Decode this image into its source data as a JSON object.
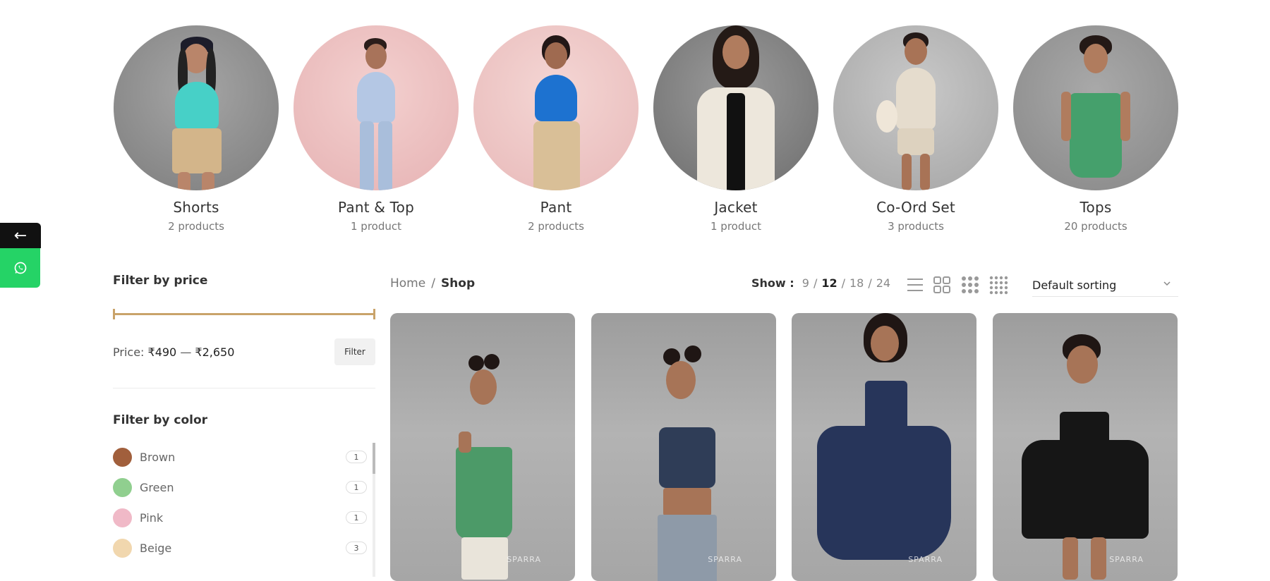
{
  "categories": [
    {
      "name": "Shorts",
      "count": "2 products"
    },
    {
      "name": "Pant & Top",
      "count": "1 product"
    },
    {
      "name": "Pant",
      "count": "2 products"
    },
    {
      "name": "Jacket",
      "count": "1 product"
    },
    {
      "name": "Co-Ord Set",
      "count": "3 products"
    },
    {
      "name": "Tops",
      "count": "20 products"
    }
  ],
  "side_tabs": {
    "back_icon": "←",
    "whatsapp_icon": "whatsapp-icon"
  },
  "price_filter": {
    "title": "Filter by price",
    "price_label": "Price:",
    "min": "₹490",
    "dash": "—",
    "max": "₹2,650",
    "button": "Filter"
  },
  "color_filter": {
    "title": "Filter by color",
    "items": [
      {
        "label": "Brown",
        "count": "1",
        "color": "#a15f3c"
      },
      {
        "label": "Green",
        "count": "1",
        "color": "#90cf8f"
      },
      {
        "label": "Pink",
        "count": "1",
        "color": "#f0b9c7"
      },
      {
        "label": "Beige",
        "count": "3",
        "color": "#f1d7ae"
      }
    ]
  },
  "breadcrumb": {
    "home": "Home",
    "sep": "/",
    "current": "Shop"
  },
  "show": {
    "label": "Show :",
    "options": [
      "9",
      "12",
      "18",
      "24"
    ],
    "active": "12"
  },
  "sorting": {
    "label": "Default sorting"
  },
  "brand_mark": "SPARRA",
  "colors": {
    "accent": "#c9a36a",
    "whatsapp": "#25d366"
  }
}
